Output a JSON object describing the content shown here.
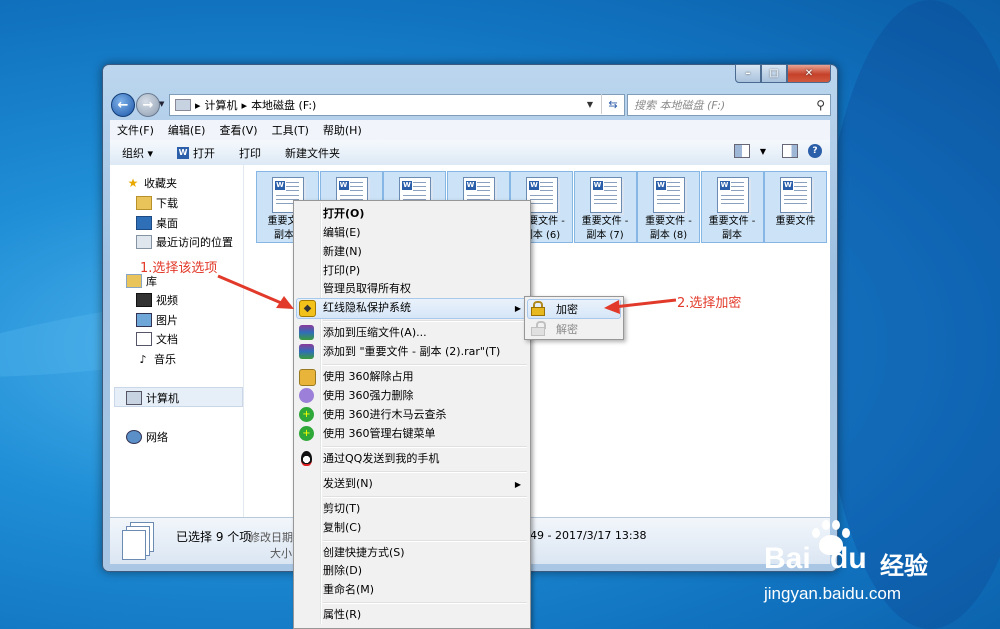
{
  "window": {
    "caption_buttons": {
      "minimize": "–",
      "maximize": "□",
      "close": "✕"
    }
  },
  "address_bar": {
    "separator1": "▸",
    "crumb1": "计算机",
    "separator2": "▸",
    "crumb2": "本地磁盘 (F:)"
  },
  "search": {
    "placeholder": "搜索 本地磁盘 (F:)"
  },
  "menubar": [
    "文件(F)",
    "编辑(E)",
    "查看(V)",
    "工具(T)",
    "帮助(H)"
  ],
  "toolbar": {
    "organize": "组织 ▾",
    "open": "打开",
    "print": "打印",
    "new_folder": "新建文件夹"
  },
  "navpane": {
    "favorites": "收藏夹",
    "downloads": "下载",
    "desktop": "桌面",
    "recent": "最近访问的位置",
    "libraries": "库",
    "videos": "视频",
    "pictures": "图片",
    "documents": "文档",
    "music": "音乐",
    "computer": "计算机",
    "network": "网络"
  },
  "files": [
    {
      "line1": "重要文件",
      "line2": "副本 ("
    },
    {
      "line1": "",
      "line2": ""
    },
    {
      "line1": "",
      "line2": ""
    },
    {
      "line1": "",
      "line2": ""
    },
    {
      "line1": "重要文件 -",
      "line2": "副本 (6)"
    },
    {
      "line1": "重要文件 -",
      "line2": "副本 (7)"
    },
    {
      "line1": "重要文件 -",
      "line2": "副本 (8)"
    },
    {
      "line1": "重要文件 -",
      "line2": "副本"
    },
    {
      "line1": "重要文件",
      "line2": ""
    }
  ],
  "status": {
    "selected": "已选择 9 个项",
    "modified_prefix": "修改日期:",
    "modified_range": "49 - 2017/3/17 13:38",
    "size_prefix": "大小:"
  },
  "context_menu": {
    "open": "打开(O)",
    "edit": "编辑(E)",
    "new": "新建(N)",
    "print": "打印(P)",
    "take_ownership": "管理员取得所有权",
    "privacy": "红线隐私保护系统",
    "add_archive": "添加到压缩文件(A)...",
    "add_rar": "添加到 \"重要文件 - 副本 (2).rar\"(T)",
    "unlock_360": "使用 360解除占用",
    "force_delete_360": "使用 360强力删除",
    "scan_360": "使用 360进行木马云查杀",
    "manage_360": "使用 360管理右键菜单",
    "qq_send": "通过QQ发送到我的手机",
    "send_to": "发送到(N)",
    "cut": "剪切(T)",
    "copy": "复制(C)",
    "create_shortcut": "创建快捷方式(S)",
    "delete": "删除(D)",
    "rename": "重命名(M)",
    "properties": "属性(R)"
  },
  "submenu": {
    "encrypt": "加密",
    "decrypt": "解密"
  },
  "annotations": {
    "step1": "1.选择该选项",
    "step2": "2.选择加密",
    "color": "#e23a2a"
  },
  "watermark": {
    "brand": "Bai",
    "brand2": "du",
    "cn": "经验",
    "url": "jingyan.baidu.com"
  }
}
